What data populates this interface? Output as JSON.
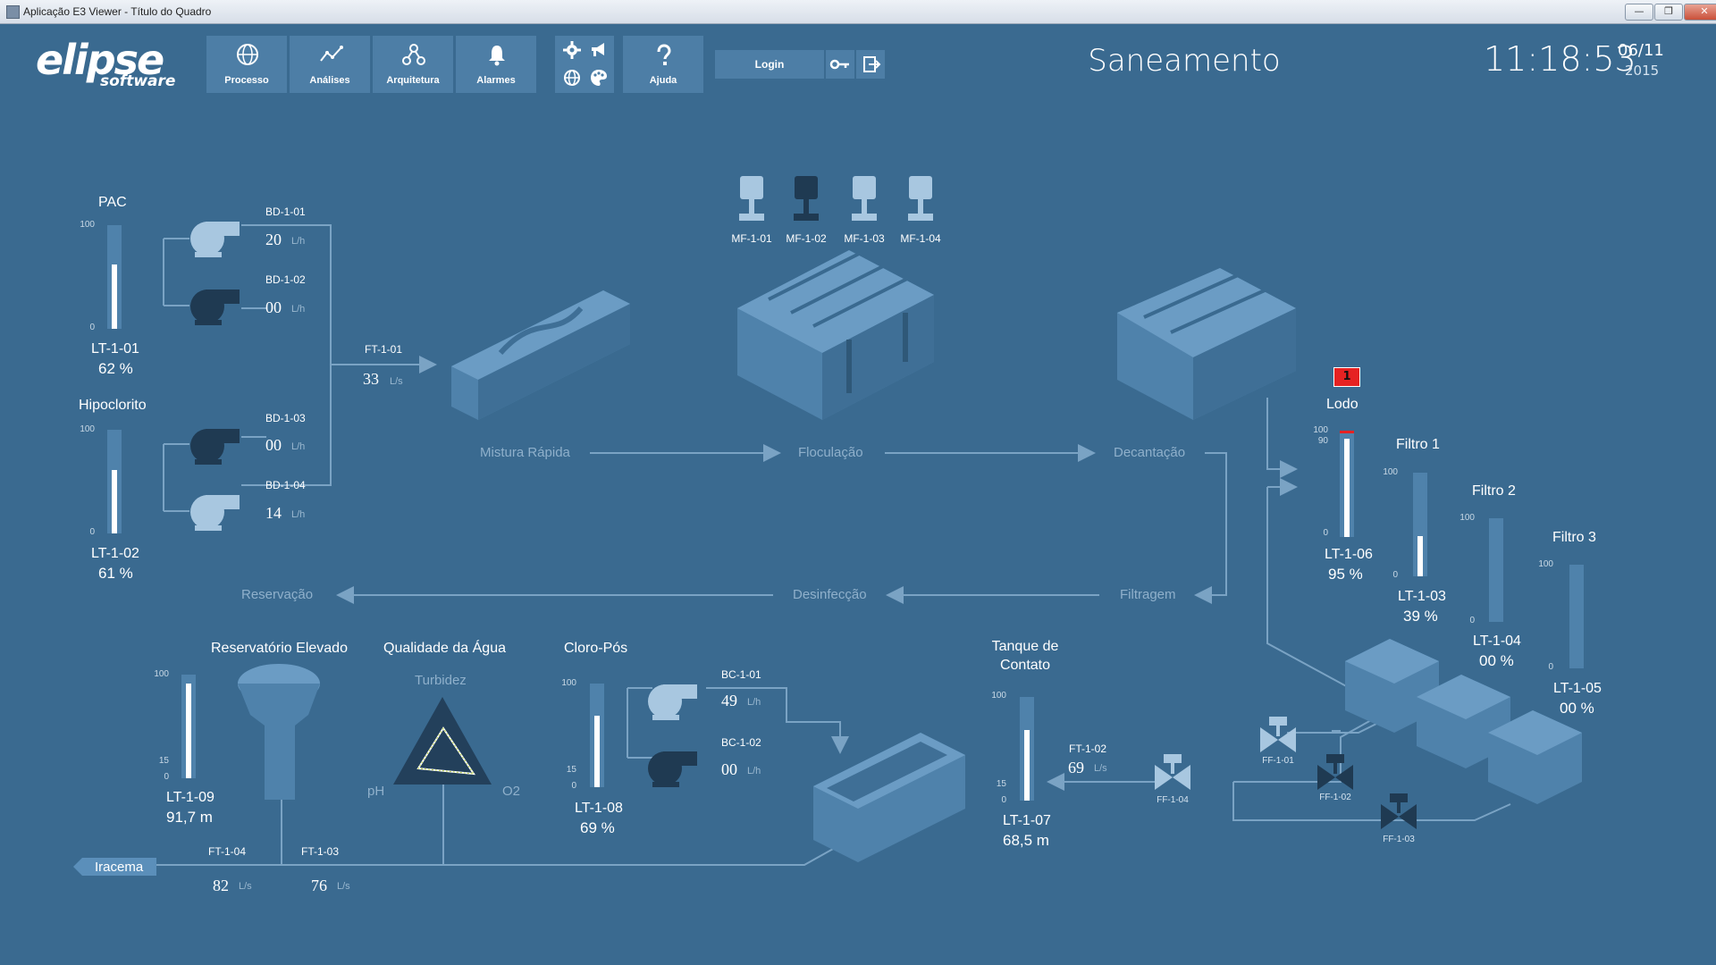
{
  "window": {
    "title": "Aplicação E3 Viewer - Título do Quadro",
    "minimize": "—",
    "maximize": "❐",
    "close": "✕"
  },
  "logo": {
    "main": "elipse",
    "sub": "software"
  },
  "toolbar": {
    "processo": "Processo",
    "analises": "Análises",
    "arquitetura": "Arquitetura",
    "alarmes": "Alarmes",
    "ajuda": "Ajuda",
    "login": "Login"
  },
  "header": {
    "title": "Saneamento",
    "time": "11:18:53",
    "date": "06/11",
    "year": "2015"
  },
  "colors": {
    "background": "#3a6a90",
    "panel": "#4d7ea6",
    "equipment_light": "#5b8fba",
    "equipment_dark": "#24415c",
    "alarm": "#e62222"
  },
  "scale": {
    "t100": "100",
    "t90": "90",
    "t15": "15",
    "t0": "0"
  },
  "pac": {
    "title": "PAC",
    "tag": "LT-1-01",
    "value": "62 %",
    "level": 0.62
  },
  "hipoclorito": {
    "title": "Hipoclorito",
    "tag": "LT-1-02",
    "value": "61 %",
    "level": 0.61
  },
  "pumps": {
    "bd101": {
      "tag": "BD-1-01",
      "value": "20",
      "unit": "L/h"
    },
    "bd102": {
      "tag": "BD-1-02",
      "value": "00",
      "unit": "L/h"
    },
    "bd103": {
      "tag": "BD-1-03",
      "value": "00",
      "unit": "L/h"
    },
    "bd104": {
      "tag": "BD-1-04",
      "value": "14",
      "unit": "L/h"
    },
    "bc101": {
      "tag": "BC-1-01",
      "value": "49",
      "unit": "L/h"
    },
    "bc102": {
      "tag": "BC-1-02",
      "value": "00",
      "unit": "L/h"
    }
  },
  "ft101": {
    "tag": "FT-1-01",
    "value": "33",
    "unit": "L/s"
  },
  "ft102": {
    "tag": "FT-1-02",
    "value": "69",
    "unit": "L/s"
  },
  "ft103": {
    "tag": "FT-1-03",
    "value": "76",
    "unit": "L/s"
  },
  "ft104": {
    "tag": "FT-1-04",
    "value": "82",
    "unit": "L/s"
  },
  "mixers": [
    "MF-1-01",
    "MF-1-02",
    "MF-1-03",
    "MF-1-04"
  ],
  "stages": {
    "mistura": "Mistura Rápida",
    "floculacao": "Floculação",
    "decantacao": "Decantação",
    "filtragem": "Filtragem",
    "desinfeccao": "Desinfecção",
    "reservacao": "Reservação"
  },
  "lodo": {
    "title": "Lodo",
    "tag": "LT-1-06",
    "value": "95 %",
    "level": 0.95,
    "alarm_count": "1"
  },
  "filtro1": {
    "title": "Filtro 1",
    "tag": "LT-1-03",
    "value": "39 %",
    "level": 0.39
  },
  "filtro2": {
    "title": "Filtro 2",
    "tag": "LT-1-04",
    "value": "00 %",
    "level": 0.0
  },
  "filtro3": {
    "title": "Filtro 3",
    "tag": "LT-1-05",
    "value": "00 %",
    "level": 0.0
  },
  "valves": [
    "FF-1-01",
    "FF-1-02",
    "FF-1-03",
    "FF-1-04"
  ],
  "reservatorio": {
    "title": "Reservatório Elevado",
    "tag": "LT-1-09",
    "value": "91,7 m",
    "level": 0.917
  },
  "qualidade": {
    "title": "Qualidade da Água",
    "turbidez": "Turbidez",
    "ph": "pH",
    "o2": "O2"
  },
  "cloro": {
    "title": "Cloro-Pós",
    "tag": "LT-1-08",
    "value": "69 %",
    "level": 0.69
  },
  "tanque": {
    "title_line1": "Tanque de",
    "title_line2": "Contato",
    "tag": "LT-1-07",
    "value": "68,5 m",
    "level": 0.685
  },
  "iracema": "Iracema"
}
